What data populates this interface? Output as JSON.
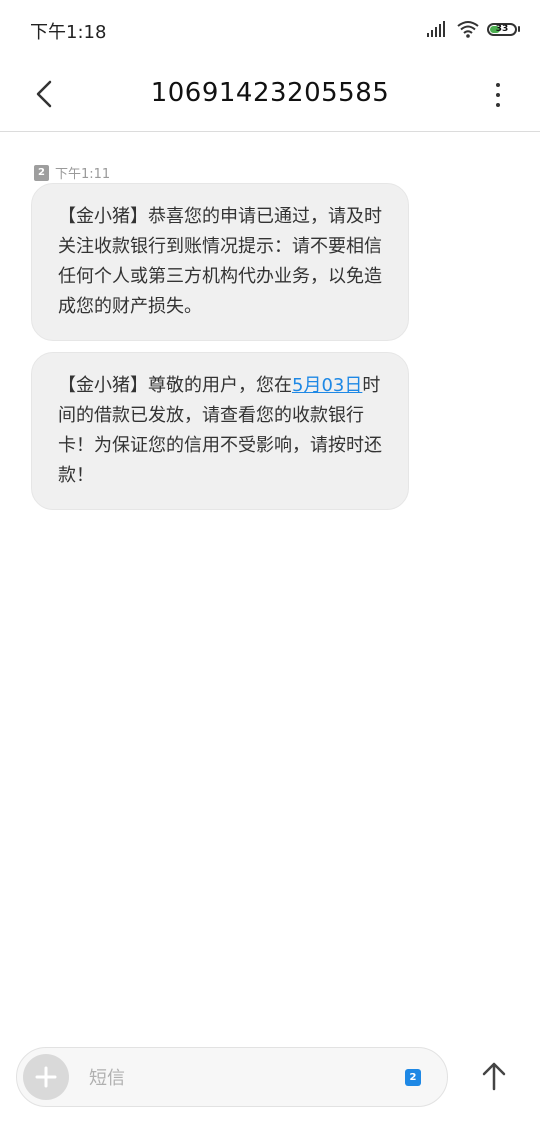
{
  "status_bar": {
    "time": "下午1:18",
    "battery": "33"
  },
  "header": {
    "title": "10691423205585"
  },
  "messages": {
    "sim": "2",
    "time": "下午1:11",
    "items": [
      {
        "text": "【金小猪】恭喜您的申请已通过，请及时关注收款银行到账情况提示：请不要相信任何个人或第三方机构代办业务，以免造成您的财产损失。"
      },
      {
        "text_before": "【金小猪】尊敬的用户，您在",
        "date_link": "5月03日",
        "text_after": "时间的借款已发放，请查看您的收款银行卡！为保证您的信用不受影响，请按时还款！"
      }
    ]
  },
  "composer": {
    "placeholder": "短信",
    "value": "",
    "sim": "2"
  },
  "colors": {
    "accent": "#1e88e5",
    "bubble": "#f0f0f0",
    "battery_fill": "#4caf50"
  },
  "icons": {
    "back": "chevron-left-icon",
    "more": "vertical-dots-icon",
    "add": "plus-icon",
    "send": "arrow-up-icon"
  }
}
